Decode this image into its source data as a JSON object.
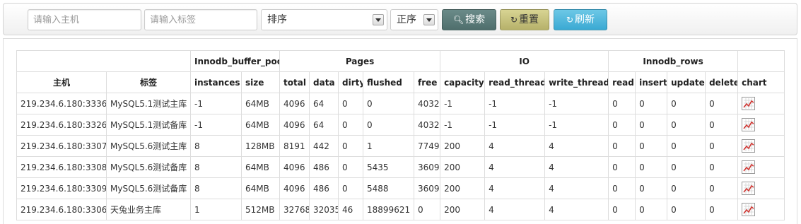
{
  "filters": {
    "host_placeholder": "请输入主机",
    "tag_placeholder": "请输入标签",
    "sort_value": "排序",
    "order_value": "正序",
    "search_label": "搜索",
    "reset_label": "重置",
    "refresh_label": "刷新",
    "search_icon": "search-icon",
    "reset_icon": "reset-icon",
    "refresh_icon": "refresh-icon"
  },
  "table": {
    "groups": {
      "buffer_pool": "Innodb_buffer_pool",
      "pages": "Pages",
      "io": "IO",
      "rows": "Innodb_rows"
    },
    "columns": {
      "host": "主机",
      "tag": "标签",
      "instances": "instances",
      "size": "size",
      "total": "total",
      "data": "data",
      "dirty": "dirty",
      "flushed": "flushed",
      "free": "free",
      "capacity": "capacity",
      "read_thread": "read_thread",
      "write_thread": "write_thread",
      "read": "read",
      "insert": "insert",
      "update": "update",
      "delete": "delete",
      "chart": "chart"
    },
    "rows": [
      {
        "host": "219.234.6.180:3336",
        "tag": "MySQL5.1测试主库",
        "instances": "-1",
        "size": "64MB",
        "total": "4096",
        "data": "64",
        "dirty": "0",
        "flushed": "0",
        "free": "4032",
        "capacity": "-1",
        "read_thread": "-1",
        "write_thread": "-1",
        "read": "0",
        "insert": "0",
        "update": "0",
        "delete": "0"
      },
      {
        "host": "219.234.6.180:3326",
        "tag": "MySQL5.1测试备库",
        "instances": "-1",
        "size": "64MB",
        "total": "4096",
        "data": "64",
        "dirty": "0",
        "flushed": "0",
        "free": "4032",
        "capacity": "-1",
        "read_thread": "-1",
        "write_thread": "-1",
        "read": "0",
        "insert": "0",
        "update": "0",
        "delete": "0"
      },
      {
        "host": "219.234.6.180:3307",
        "tag": "MySQL5.6测试主库",
        "instances": "8",
        "size": "128MB",
        "total": "8191",
        "data": "442",
        "dirty": "0",
        "flushed": "1",
        "free": "7749",
        "capacity": "200",
        "read_thread": "4",
        "write_thread": "4",
        "read": "0",
        "insert": "0",
        "update": "0",
        "delete": "0"
      },
      {
        "host": "219.234.6.180:3308",
        "tag": "MySQL5.6测试备库",
        "instances": "8",
        "size": "64MB",
        "total": "4096",
        "data": "486",
        "dirty": "0",
        "flushed": "5435",
        "free": "3609",
        "capacity": "200",
        "read_thread": "4",
        "write_thread": "4",
        "read": "0",
        "insert": "0",
        "update": "0",
        "delete": "0"
      },
      {
        "host": "219.234.6.180:3309",
        "tag": "MySQL5.6测试备库",
        "instances": "8",
        "size": "64MB",
        "total": "4096",
        "data": "486",
        "dirty": "0",
        "flushed": "5488",
        "free": "3609",
        "capacity": "200",
        "read_thread": "4",
        "write_thread": "4",
        "read": "0",
        "insert": "0",
        "update": "0",
        "delete": "0"
      },
      {
        "host": "219.234.6.180:3306",
        "tag": "天兔业务主库",
        "instances": "1",
        "size": "512MB",
        "total": "32768",
        "data": "32035",
        "dirty": "46",
        "flushed": "18899621",
        "free": "0",
        "capacity": "200",
        "read_thread": "4",
        "write_thread": "4",
        "read": "0",
        "insert": "0",
        "update": "0",
        "delete": "0"
      }
    ],
    "chart_icon": "line-chart-icon"
  }
}
